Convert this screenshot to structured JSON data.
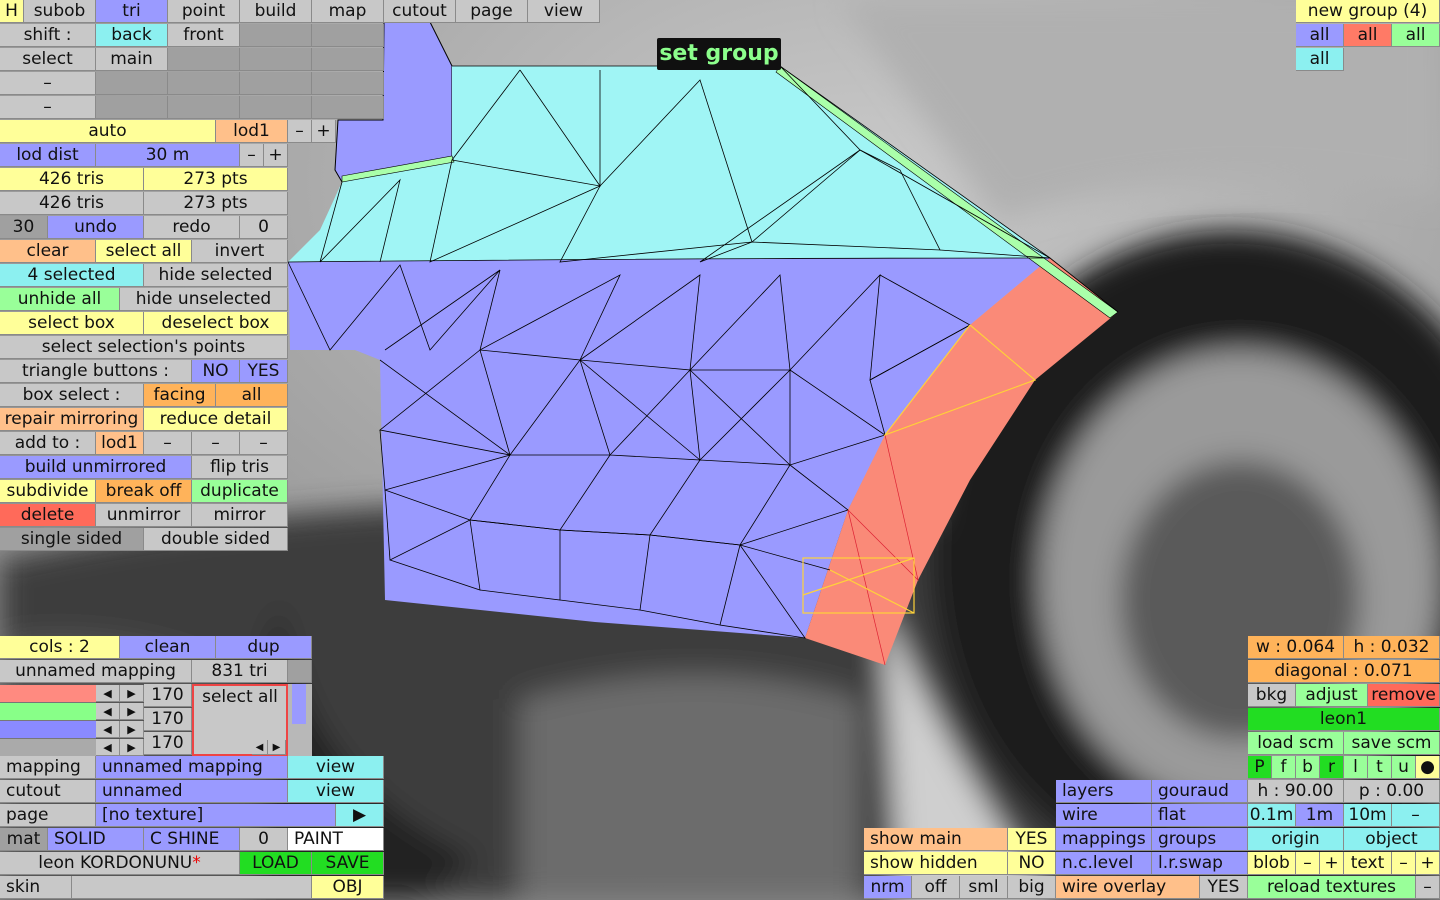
{
  "top_tabs": [
    "H",
    "subob",
    "tri",
    "point",
    "build",
    "map",
    "cutout",
    "page",
    "view"
  ],
  "shift_label": "shift :",
  "shift_back": "back",
  "shift_front": "front",
  "select_label": "select",
  "select_main": "main",
  "dash": "–",
  "auto": "auto",
  "lod1": "lod1",
  "minus": "–",
  "plus": "+",
  "lod_dist_label": "lod dist",
  "lod_dist_value": "30 m",
  "tris1": "426 tris",
  "pts1": "273 pts",
  "tris2": "426 tris",
  "pts2": "273 pts",
  "undo_count": "30",
  "undo": "undo",
  "redo": "redo",
  "redo_count": "0",
  "clear": "clear",
  "select_all": "select all",
  "invert": "invert",
  "selected_count": "4 selected",
  "hide_selected": "hide selected",
  "unhide_all": "unhide all",
  "hide_unselected": "hide unselected",
  "select_box": "select box",
  "deselect_box": "deselect box",
  "select_selections_points": "select selection's points",
  "triangle_buttons": "triangle buttons :",
  "no": "NO",
  "yes": "YES",
  "box_select": "box select :",
  "facing": "facing",
  "all": "all",
  "repair_mirroring": "repair mirroring",
  "reduce_detail": "reduce detail",
  "add_to": "add to :",
  "build_unmirrored": "build unmirrored",
  "flip_tris": "flip tris",
  "subdivide": "subdivide",
  "break_off": "break off",
  "duplicate": "duplicate",
  "delete": "delete",
  "unmirror": "unmirror",
  "mirror": "mirror",
  "single_sided": "single sided",
  "double_sided": "double sided",
  "set_group": "set group",
  "new_group": "new group (4)",
  "cols": "cols : 2",
  "clean": "clean",
  "dup": "dup",
  "unnamed_mapping": "unnamed mapping",
  "tri_count": "831 tri",
  "channel_values": [
    "170",
    "170",
    "170"
  ],
  "arrow_left": "◀",
  "arrow_right": "▶",
  "mapping": "mapping",
  "view": "view",
  "cutout": "cutout",
  "unnamed": "unnamed",
  "page": "page",
  "no_texture": "[no texture]",
  "play": "▶",
  "mat": "mat",
  "solid": "SOLID",
  "c_shine": "C SHINE",
  "zero": "0",
  "paint": "PAINT",
  "material_name": "leon KORDONUNU",
  "asterisk": "*",
  "load": "LOAD",
  "save": "SAVE",
  "skin": "skin",
  "obj": "OBJ",
  "show_main": "show main",
  "show_hidden": "show hidden",
  "nrm": "nrm",
  "off": "off",
  "sml": "sml",
  "big": "big",
  "layers": "layers",
  "gouraud": "gouraud",
  "wire": "wire",
  "flat": "flat",
  "mappings": "mappings",
  "groups": "groups",
  "nc_level": "n.c.level",
  "lr_swap": "l.r.swap",
  "wire_overlay": "wire overlay",
  "w_value": "w : 0.064",
  "h_value": "h : 0.032",
  "diagonal": "diagonal : 0.071",
  "bkg": "bkg",
  "adjust": "adjust",
  "remove": "remove",
  "leon1": "leon1",
  "load_scm": "load scm",
  "save_scm": "save scm",
  "view_buttons": [
    "P",
    "f",
    "b",
    "r",
    "l",
    "t",
    "u",
    "●"
  ],
  "h_angle": "h : 90.00",
  "p_angle": "p : 0.00",
  "scale_01": "0.1m",
  "scale_1": "1m",
  "scale_10": "10m",
  "origin": "origin",
  "object": "object",
  "blob": "blob",
  "text": "text",
  "reload_textures": "reload textures",
  "colors": {
    "blue": "#9a9aff",
    "cyan": "#8cf0f0",
    "yellow": "#ffff99",
    "orange": "#ffb35a",
    "green": "#99ff99",
    "red": "#ff6a5a",
    "salmon_mesh": "#fa8a78"
  }
}
